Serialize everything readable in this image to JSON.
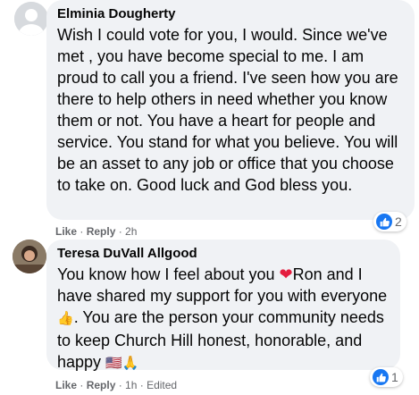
{
  "comments": [
    {
      "author": "Elminia Dougherty",
      "text": "Wish I could vote for you, I would. Since we've met , you have become special to me. I am proud to call you a friend. I've seen how you are there to help others in need whether you know them or not. You have a heart for people and service. You stand for what you believe. You will be an asset to any job or office that you choose to take on. Good luck and God bless you.",
      "like_label": "Like",
      "reply_label": "Reply",
      "separator": " · ",
      "time": "2h",
      "reaction_count": "2",
      "reaction_icon": "thumbs-up-icon"
    },
    {
      "author": "Teresa DuVall Allgood",
      "text_part1": "You know how I feel about you ",
      "heart": "❤",
      "text_part2": "Ron and I have shared my support for you with everyone ",
      "thumb": "👍",
      "text_part3": ". You are the person your community needs to keep Church Hill honest, honorable, and happy ",
      "flag": "🇺🇸",
      "pray": "🙏",
      "like_label": "Like",
      "reply_label": "Reply",
      "separator": " · ",
      "time": "1h",
      "edited": "Edited",
      "reaction_count": "1",
      "reaction_icon": "thumbs-up-icon"
    }
  ],
  "colors": {
    "bubble_bg": "#f0f2f5",
    "meta_text": "#65676b",
    "like_blue": "#1877f2",
    "heart_red": "#e41e3f"
  }
}
